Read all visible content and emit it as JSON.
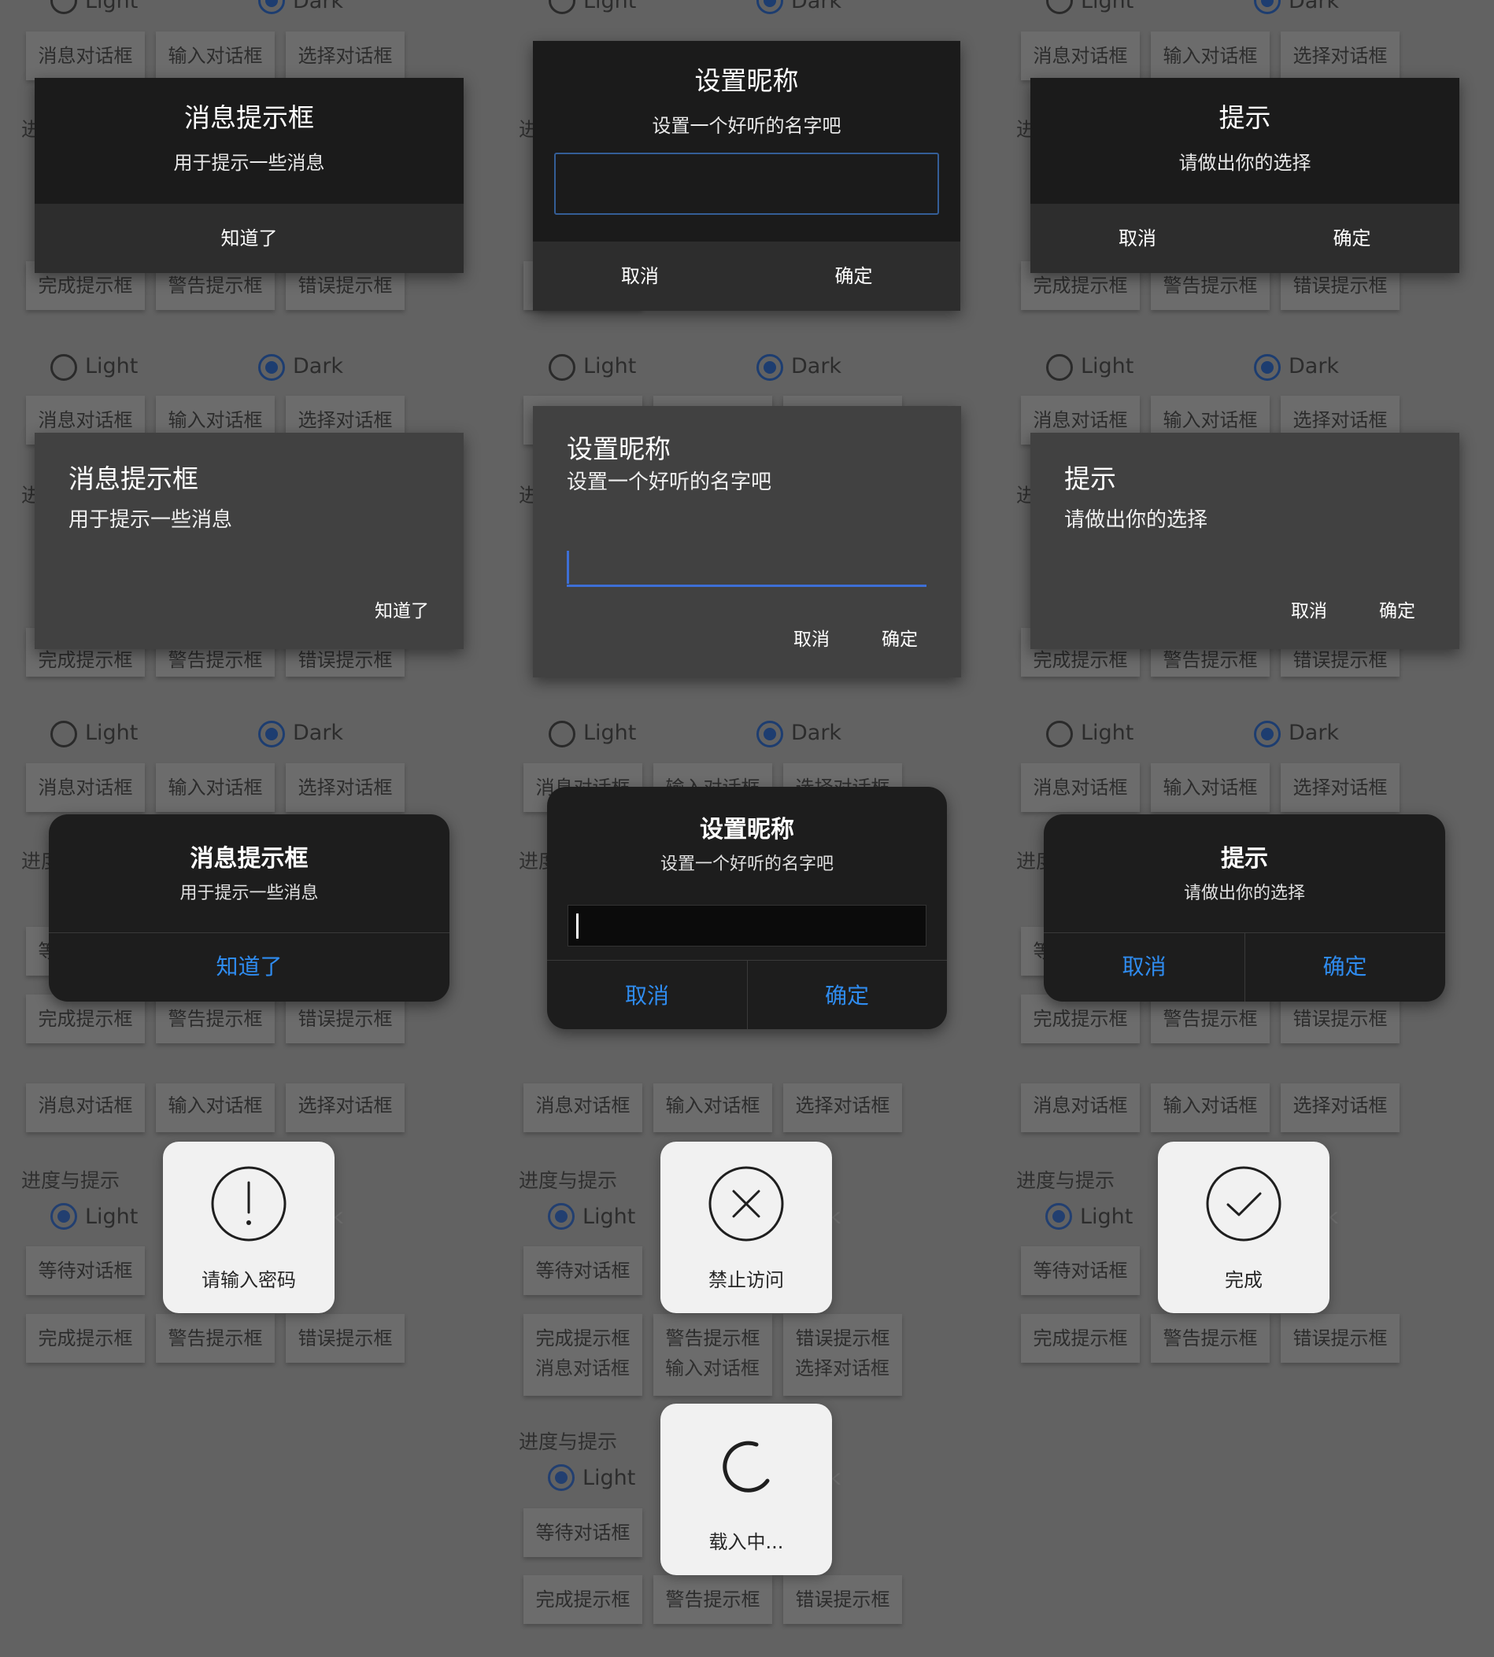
{
  "bg": {
    "light": "Light",
    "dark": "Dark",
    "btn_message": "消息对话框",
    "btn_input": "输入对话框",
    "btn_select": "选择对话框",
    "btn_done": "完成提示框",
    "btn_warn": "警告提示框",
    "btn_error": "错误提示框",
    "btn_wait": "等待对话框",
    "progress_label": "进度与提示",
    "progress_short": "进"
  },
  "message_dialog": {
    "title": "消息提示框",
    "message": "用于提示一些消息",
    "ok": "知道了"
  },
  "input_dialog": {
    "title": "设置昵称",
    "message": "设置一个好听的名字吧",
    "cancel": "取消",
    "ok": "确定"
  },
  "select_dialog": {
    "title": "提示",
    "message": "请做出你的选择",
    "cancel": "取消",
    "ok": "确定"
  },
  "toasts": {
    "warning": {
      "icon": "exclamation-circle-icon",
      "label": "请输入密码"
    },
    "error": {
      "icon": "x-circle-icon",
      "label": "禁止访问"
    },
    "success": {
      "icon": "check-circle-icon",
      "label": "完成"
    },
    "loading": {
      "icon": "spinner-icon",
      "label": "载入中..."
    }
  },
  "colors": {
    "ios_accent": "#2f8cf0",
    "material_accent": "#3d6fd6",
    "overlay": "#626262"
  }
}
